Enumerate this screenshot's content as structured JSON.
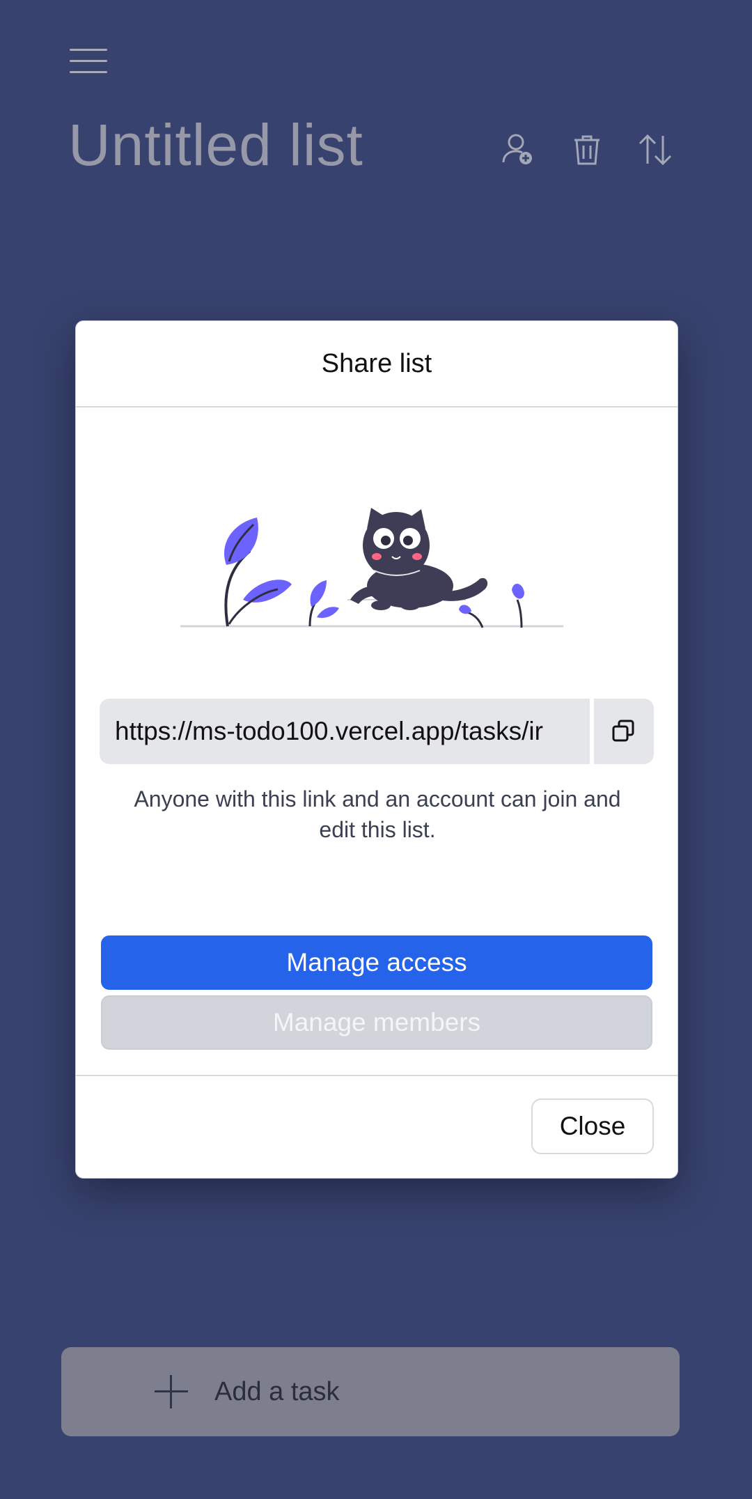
{
  "header": {
    "title": "Untitled list",
    "menu_icon": "hamburger-menu-icon",
    "actions": [
      {
        "name": "add-member-icon"
      },
      {
        "name": "trash-icon"
      },
      {
        "name": "sort-icon"
      }
    ]
  },
  "dialog": {
    "title": "Share list",
    "illustration": "cat-with-leaves",
    "share_link": "https://ms-todo100.vercel.app/tasks/ir",
    "copy_icon": "copy-icon",
    "note": "Anyone with this link and an account can join and edit this list.",
    "manage_access_label": "Manage access",
    "manage_members_label": "Manage members",
    "close_label": "Close"
  },
  "footer": {
    "add_task_label": "Add a task",
    "add_icon": "plus-icon"
  },
  "colors": {
    "background": "#37426e",
    "primary": "#2563eb",
    "accent_illustration": "#6c63ff"
  }
}
